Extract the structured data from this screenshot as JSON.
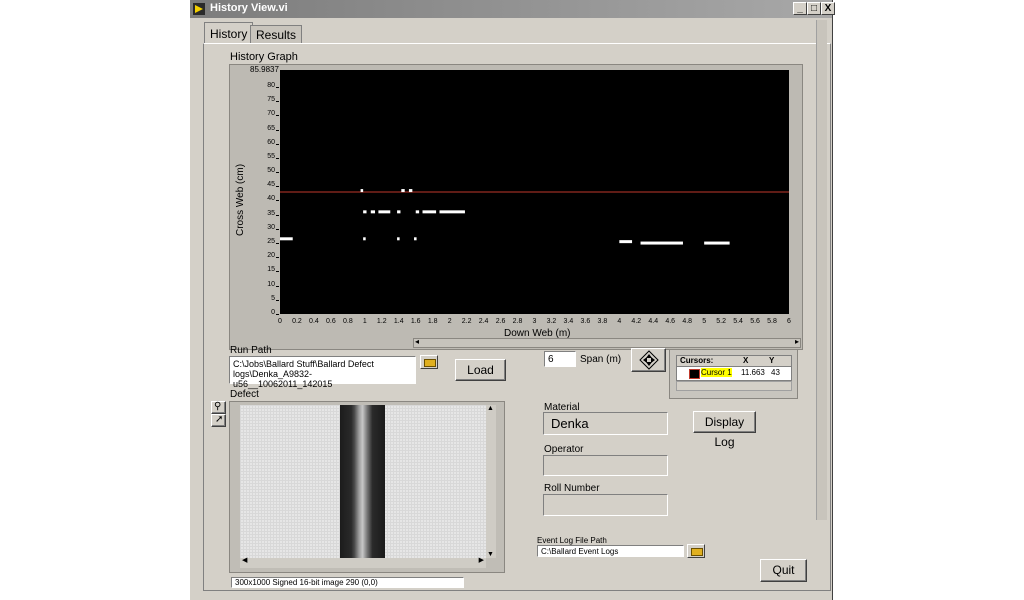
{
  "window": {
    "title": "History View.vi",
    "minimize": "_",
    "maximize": "□",
    "close": "X"
  },
  "tabs": [
    {
      "label": "History",
      "active": true
    },
    {
      "label": "Results",
      "active": false
    }
  ],
  "graph": {
    "label": "History Graph",
    "max_label": "85.9837",
    "ylabel": "Cross Web (cm)",
    "xlabel": "Down Web (m)"
  },
  "chart_data": {
    "type": "scatter",
    "title": "History Graph",
    "xlabel": "Down Web (m)",
    "ylabel": "Cross Web (cm)",
    "xlim": [
      0,
      6
    ],
    "ylim": [
      0,
      85.9837
    ],
    "x_ticks": [
      "0",
      "0.2",
      "0.4",
      "0.6",
      "0.8",
      "1",
      "1.2",
      "1.4",
      "1.6",
      "1.8",
      "2",
      "2.2",
      "2.4",
      "2.6",
      "2.8",
      "3",
      "3.2",
      "3.4",
      "3.6",
      "3.8",
      "4",
      "4.2",
      "4.4",
      "4.6",
      "4.8",
      "5",
      "5.2",
      "5.4",
      "5.6",
      "5.8",
      "6"
    ],
    "y_ticks": [
      "0",
      "5",
      "10",
      "15",
      "20",
      "25",
      "30",
      "35",
      "40",
      "45",
      "50",
      "55",
      "60",
      "65",
      "70",
      "75",
      "80"
    ],
    "cursor_line_y": 43,
    "cursor_color": "#c0392b",
    "defect_color": "#ffffff",
    "defects": [
      {
        "x": [
          0.0,
          0.15
        ],
        "y": 26.5
      },
      {
        "x": [
          0.95,
          0.98
        ],
        "y": 43.5
      },
      {
        "x": [
          0.98,
          1.02
        ],
        "y": 36
      },
      {
        "x": [
          1.07,
          1.12
        ],
        "y": 36
      },
      {
        "x": [
          1.16,
          1.3
        ],
        "y": 36
      },
      {
        "x": [
          1.38,
          1.42
        ],
        "y": 36
      },
      {
        "x": [
          1.43,
          1.47
        ],
        "y": 43.5
      },
      {
        "x": [
          1.52,
          1.56
        ],
        "y": 43.5
      },
      {
        "x": [
          1.6,
          1.64
        ],
        "y": 36
      },
      {
        "x": [
          1.68,
          1.84
        ],
        "y": 36
      },
      {
        "x": [
          1.88,
          2.18
        ],
        "y": 36
      },
      {
        "x": [
          0.98,
          1.01
        ],
        "y": 26.5
      },
      {
        "x": [
          1.38,
          1.41
        ],
        "y": 26.5
      },
      {
        "x": [
          1.58,
          1.61
        ],
        "y": 26.5
      },
      {
        "x": [
          4.0,
          4.15
        ],
        "y": 25.5
      },
      {
        "x": [
          4.25,
          4.75
        ],
        "y": 25
      },
      {
        "x": [
          5.0,
          5.3
        ],
        "y": 25
      }
    ]
  },
  "run_path": {
    "label": "Run Path",
    "value_line1": "C:\\Jobs\\Ballard Stuff\\Ballard Defect logs\\Denka_A9832-",
    "value_line2": "u56__10062011_142015"
  },
  "load_button": "Load",
  "span": {
    "value": "6",
    "label": "Span (m)"
  },
  "cursor_table": {
    "header": [
      "Cursors:",
      "X",
      "Y"
    ],
    "row": {
      "name": "Cursor 1",
      "x": "11.663",
      "y": "43"
    },
    "highlight": "#ffff00",
    "cursor_color": "#c0392b"
  },
  "defect_section": {
    "label": "Defect",
    "status": "300x1000 Signed 16-bit image 290    (0,0)"
  },
  "material": {
    "label": "Material",
    "value": "Denka"
  },
  "operator": {
    "label": "Operator",
    "value": ""
  },
  "roll_number": {
    "label": "Roll Number",
    "value": ""
  },
  "display_log_button": "Display Log",
  "event_log": {
    "label": "Event Log File Path",
    "value": "C:\\Ballard Event Logs"
  },
  "quit_button": "Quit",
  "colors": {
    "window_bg": "#d4d0c8",
    "plot_bg": "#000000"
  }
}
